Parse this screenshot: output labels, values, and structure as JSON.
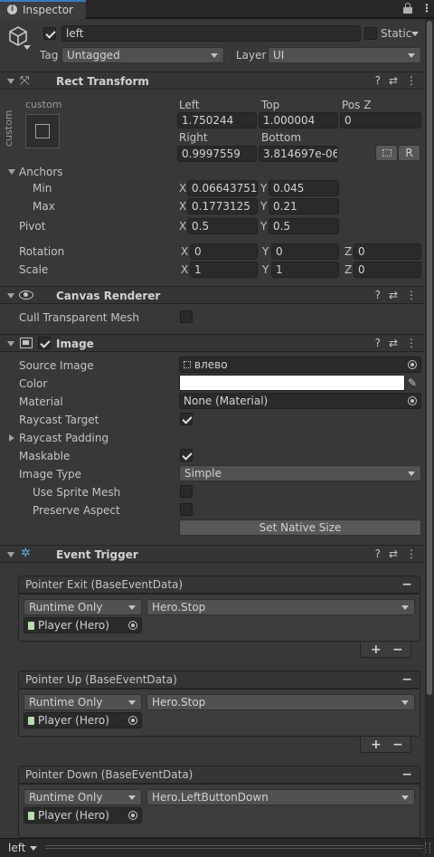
{
  "tab": {
    "title": "Inspector",
    "lock_icon": "lock-icon",
    "menu_icon": "kebab-icon"
  },
  "gameobject": {
    "name": "left",
    "static_label": "Static",
    "tag_label": "Tag",
    "tag_value": "Untagged",
    "layer_label": "Layer",
    "layer_value": "UI"
  },
  "rect_transform": {
    "title": "Rect Transform",
    "anchor_preset": "custom",
    "anchor_preset_side": "custom",
    "left_label": "Left",
    "left_value": "1.750244",
    "top_label": "Top",
    "top_value": "1.000004",
    "posz_label": "Pos Z",
    "posz_value": "0",
    "right_label": "Right",
    "right_value": "0.9997559",
    "bottom_label": "Bottom",
    "bottom_value": "3.814697e-06",
    "r_button": "R",
    "anchors_label": "Anchors",
    "min_label": "Min",
    "min_x": "0.06643751",
    "min_y": "0.045",
    "max_label": "Max",
    "max_x": "0.1773125",
    "max_y": "0.21",
    "pivot_label": "Pivot",
    "pivot_x": "0.5",
    "pivot_y": "0.5",
    "rotation_label": "Rotation",
    "rot_x": "0",
    "rot_y": "0",
    "rot_z": "0",
    "scale_label": "Scale",
    "scale_x": "1",
    "scale_y": "1",
    "scale_z": "0",
    "x": "X",
    "y": "Y",
    "z": "Z"
  },
  "canvas_renderer": {
    "title": "Canvas Renderer",
    "cull_label": "Cull Transparent Mesh",
    "cull_checked": false
  },
  "image": {
    "title": "Image",
    "source_label": "Source Image",
    "source_value": "влево",
    "color_label": "Color",
    "color_value": "#ffffff",
    "material_label": "Material",
    "material_value": "None (Material)",
    "raycast_label": "Raycast Target",
    "raycast_checked": true,
    "padding_label": "Raycast Padding",
    "maskable_label": "Maskable",
    "maskable_checked": true,
    "type_label": "Image Type",
    "type_value": "Simple",
    "sprite_mesh_label": "Use Sprite Mesh",
    "sprite_mesh_checked": false,
    "preserve_label": "Preserve Aspect",
    "preserve_checked": false,
    "native_size_button": "Set Native Size"
  },
  "event_trigger": {
    "title": "Event Trigger",
    "entries": [
      {
        "header": "Pointer Exit (BaseEventData)",
        "mode": "Runtime Only",
        "function": "Hero.Stop",
        "target": "Player  (Hero)"
      },
      {
        "header": "Pointer Up (BaseEventData)",
        "mode": "Runtime Only",
        "function": "Hero.Stop",
        "target": "Player  (Hero)"
      },
      {
        "header": "Pointer Down (BaseEventData)",
        "mode": "Runtime Only",
        "function": "Hero.LeftButtonDown",
        "target": "Player  (Hero)"
      }
    ],
    "plus": "+",
    "minus": "−"
  },
  "footer": {
    "selection": "left"
  },
  "colors": {
    "accent_blue": "#3a79bb",
    "background": "#383838",
    "header": "#353535"
  }
}
